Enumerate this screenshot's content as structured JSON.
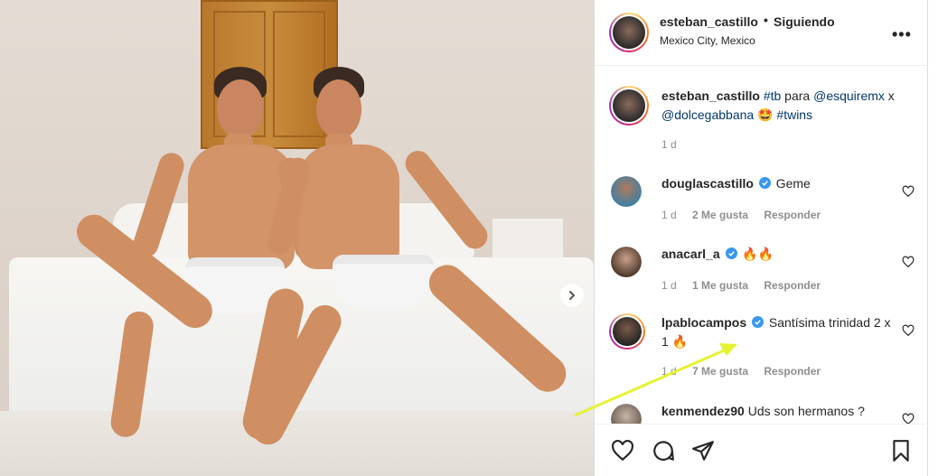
{
  "post": {
    "author": "esteban_castillo",
    "follow_separator": "•",
    "follow_label": "Siguiendo",
    "location": "Mexico City, Mexico",
    "more_label": "•••"
  },
  "caption": {
    "user": "esteban_castillo",
    "parts": [
      "#tb",
      " para ",
      "@esquiremx",
      " x ",
      "@dolcegabbana",
      " 🤩 ",
      "#twins"
    ],
    "time": "1 d"
  },
  "comments": [
    {
      "user": "douglascastillo",
      "verified": true,
      "text": "Geme",
      "time": "1 d",
      "likes": "2 Me gusta",
      "reply": "Responder"
    },
    {
      "user": "anacarl_a",
      "verified": true,
      "text": "🔥🔥",
      "time": "1 d",
      "likes": "1 Me gusta",
      "reply": "Responder"
    },
    {
      "user": "lpablocampos",
      "verified": true,
      "text": "Santísima trinidad 2 x 1 🔥",
      "time": "1 d",
      "likes": "7 Me gusta",
      "reply": "Responder"
    },
    {
      "user": "kenmendez90",
      "verified": false,
      "text": "Uds son hermanos ?",
      "time": "",
      "likes": "",
      "reply": ""
    }
  ],
  "colors": {
    "link": "#00376b",
    "verified": "#3897f0",
    "annotation_arrow": "#e6f230"
  },
  "icons": [
    "heart-icon",
    "comment-icon",
    "share-icon",
    "bookmark-icon",
    "more-options-icon",
    "next-photo-icon",
    "verified-badge-icon"
  ]
}
